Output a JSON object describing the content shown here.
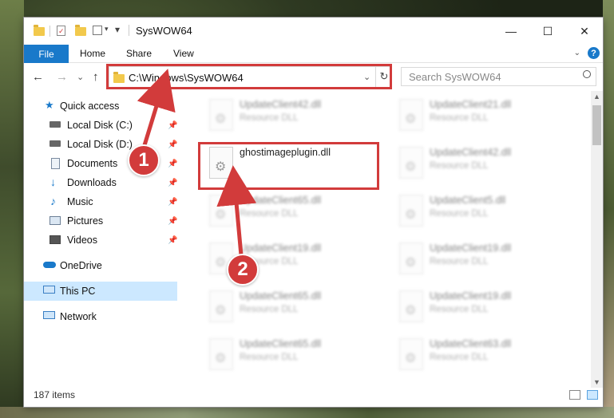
{
  "window": {
    "title": "SysWOW64",
    "controls": {
      "minimize": "—",
      "maximize": "☐",
      "close": "✕"
    }
  },
  "ribbon": {
    "file_tab": "File",
    "tabs": [
      "Home",
      "Share",
      "View"
    ],
    "help": "?"
  },
  "navigation": {
    "back": "←",
    "forward": "→",
    "recent": "⌄",
    "up": "↑",
    "address": "C:\\Windows\\SysWOW64",
    "refresh": "↻",
    "search_placeholder": "Search SysWOW64",
    "search_icon": "magnifier-icon"
  },
  "sidebar": {
    "quick_access": "Quick access",
    "items": [
      {
        "label": "Local Disk (C:)",
        "icon": "drive-icon",
        "pinned": true
      },
      {
        "label": "Local Disk (D:)",
        "icon": "drive-icon",
        "pinned": true
      },
      {
        "label": "Documents",
        "icon": "documents-icon",
        "pinned": true
      },
      {
        "label": "Downloads",
        "icon": "downloads-icon",
        "pinned": true
      },
      {
        "label": "Music",
        "icon": "music-icon",
        "pinned": true
      },
      {
        "label": "Pictures",
        "icon": "pictures-icon",
        "pinned": true
      },
      {
        "label": "Videos",
        "icon": "videos-icon",
        "pinned": true
      }
    ],
    "onedrive": "OneDrive",
    "this_pc": "This PC",
    "network": "Network"
  },
  "files": {
    "left": [
      {
        "name": "UpdateClient42.dll",
        "type": "Resource DLL"
      },
      {
        "name": "ghostimageplugin.dll",
        "type": ""
      },
      {
        "name": "UpdateClient65.dll",
        "type": "Resource DLL"
      },
      {
        "name": "UpdateClient19.dll",
        "type": "Resource DLL"
      },
      {
        "name": "UpdateClient65.dll",
        "type": "Resource DLL"
      },
      {
        "name": "UpdateClient65.dll",
        "type": "Resource DLL"
      }
    ],
    "right": [
      {
        "name": "UpdateClient21.dll",
        "type": "Resource DLL"
      },
      {
        "name": "UpdateClient42.dll",
        "type": "Resource DLL"
      },
      {
        "name": "UpdateClient5.dll",
        "type": "Resource DLL"
      },
      {
        "name": "UpdateClient19.dll",
        "type": "Resource DLL"
      },
      {
        "name": "UpdateClient19.dll",
        "type": "Resource DLL"
      },
      {
        "name": "UpdateClient63.dll",
        "type": "Resource DLL"
      }
    ]
  },
  "status": {
    "item_count": "187 items"
  },
  "annotations": {
    "step1": "1",
    "step2": "2",
    "accent": "#d23b3b"
  }
}
